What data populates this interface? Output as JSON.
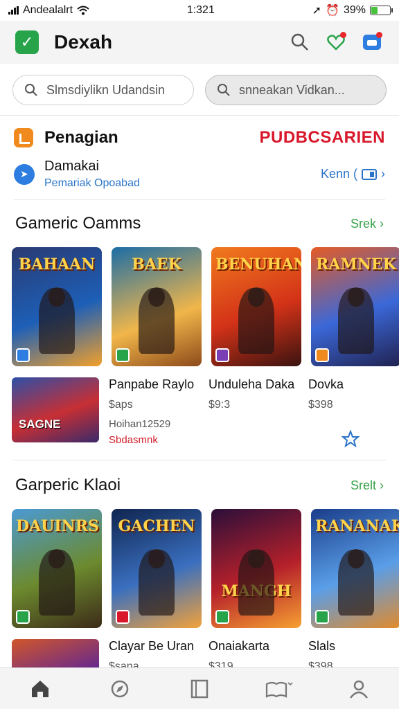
{
  "status": {
    "carrier": "Andealalrt",
    "time": "1:321",
    "battery": "39%"
  },
  "app": {
    "name": "Dexah"
  },
  "search": {
    "left_placeholder": "Slmsdiylikn Udandsin",
    "right_placeholder": "snneakan Vidkan..."
  },
  "promo": {
    "title": "Penagian",
    "badge": "PUDBCSARIEN",
    "row_title": "Damakai",
    "row_sub": "Pemariak Opoabad",
    "row_more": "Kenn ("
  },
  "section1": {
    "title": "Gameric Oamms",
    "see_all": "Srek",
    "tiles": [
      {
        "banner": "BAHAAN"
      },
      {
        "banner": "BAEK"
      },
      {
        "banner": "BENUHAN"
      },
      {
        "banner": "RAMNEK"
      }
    ],
    "list": {
      "thumb_label": "SAGNE",
      "items": [
        {
          "name": "Panpabe Raylo",
          "price": "$aps",
          "small": "Hoihan12529",
          "red": "Sbdasmnk"
        },
        {
          "name": "Unduleha Daka",
          "price": "$9:3"
        },
        {
          "name": "Dovka",
          "price": "$398"
        }
      ]
    }
  },
  "section2": {
    "title": "Garperic Klaoi",
    "see_all": "Srelt",
    "tiles": [
      {
        "banner": "DAUINRS"
      },
      {
        "banner": "GACHEN"
      },
      {
        "banner": "MANGH"
      },
      {
        "banner": "RANANAK"
      }
    ],
    "list": {
      "items": [
        {
          "name": "Clayar Be Uran",
          "price": "$sana"
        },
        {
          "name": "Onaiakarta",
          "price": "$319"
        },
        {
          "name": "Slals",
          "price": "$398"
        }
      ]
    }
  }
}
